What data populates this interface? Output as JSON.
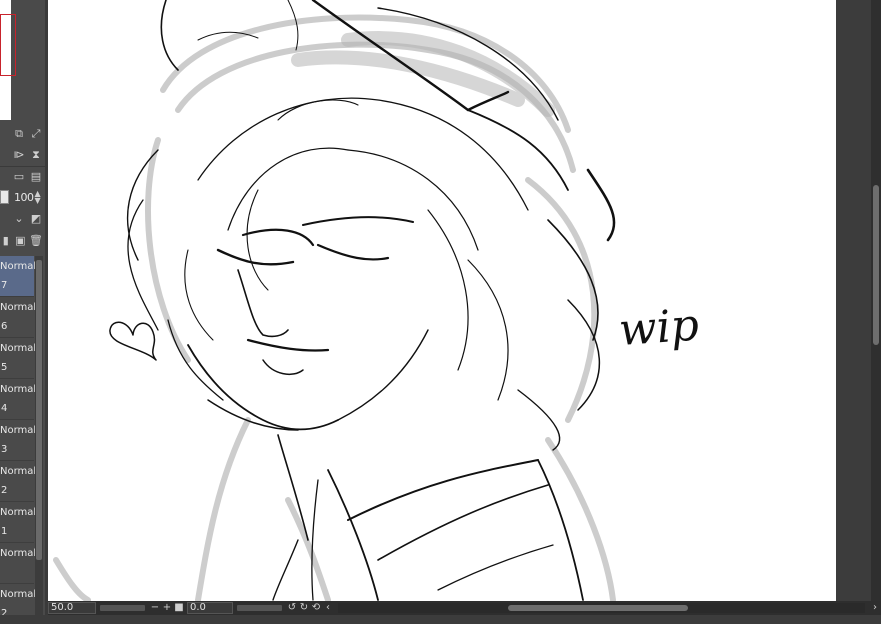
{
  "layer_properties": {
    "opacity_value": "100"
  },
  "layers": [
    {
      "blend": "Normal",
      "name": "7",
      "selected": true
    },
    {
      "blend": "Normal",
      "name": "6",
      "selected": false
    },
    {
      "blend": "Normal",
      "name": "5",
      "selected": false
    },
    {
      "blend": "Normal",
      "name": "4",
      "selected": false
    },
    {
      "blend": "Normal",
      "name": "3",
      "selected": false
    },
    {
      "blend": "Normal",
      "name": "2",
      "selected": false
    },
    {
      "blend": "Normal",
      "name": "1",
      "selected": false
    },
    {
      "blend": "Normal",
      "name": "",
      "selected": false
    },
    {
      "blend": "Normal",
      "name": "2",
      "selected": false
    }
  ],
  "canvas": {
    "annotation_text": "wip"
  },
  "status_bar": {
    "zoom_value": "50.0",
    "rotation_value": "0.0",
    "zoom_out_symbol": "−",
    "zoom_in_symbol": "+",
    "rotate_left_symbol": "↺",
    "rotate_right_symbol": "↻",
    "reset_symbol": "⟲",
    "scroll_left_symbol": "‹",
    "scroll_right_symbol": "›"
  },
  "icons": {
    "colors": {
      "selected_layer": "#5a6a8a",
      "navigator_frame": "#c8232c"
    }
  }
}
